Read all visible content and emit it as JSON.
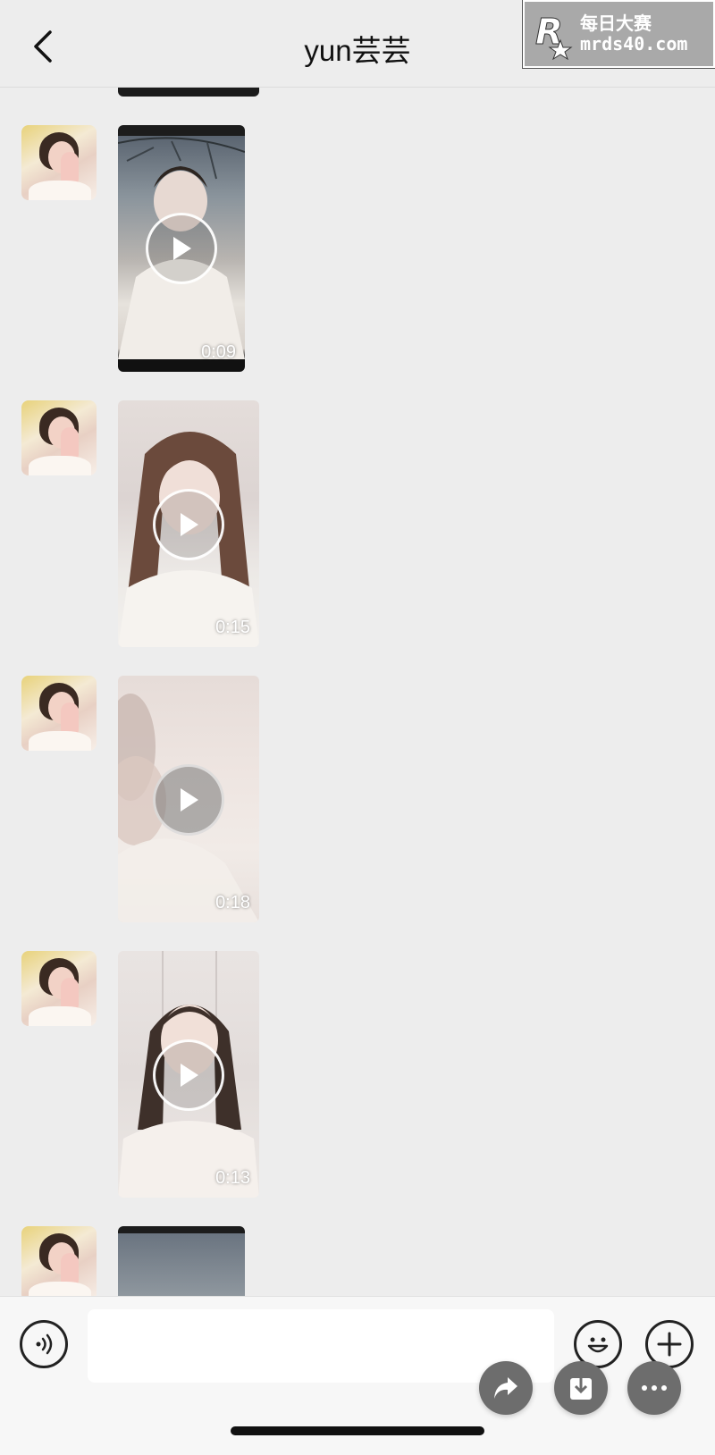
{
  "header": {
    "title": "yun芸芸",
    "more_label": "..."
  },
  "watermark": {
    "logo": "R",
    "cn_text": "每日大赛",
    "url": "mrds40.com"
  },
  "messages": [
    {
      "sender": "yun芸芸",
      "type": "video",
      "duration": "0:09"
    },
    {
      "sender": "yun芸芸",
      "type": "video",
      "duration": "0:15"
    },
    {
      "sender": "yun芸芸",
      "type": "video",
      "duration": "0:18"
    },
    {
      "sender": "yun芸芸",
      "type": "video",
      "duration": "0:13"
    }
  ],
  "input": {
    "value": "",
    "placeholder": ""
  },
  "icons": {
    "back": "chevron-left-icon",
    "voice": "voice-icon",
    "emoji": "emoji-icon",
    "plus": "plus-icon",
    "share": "share-icon",
    "save": "download-icon",
    "more": "more-icon"
  },
  "colors": {
    "background": "#ededed",
    "input_bar": "#f7f7f7",
    "fab": "#6d6d6d"
  }
}
